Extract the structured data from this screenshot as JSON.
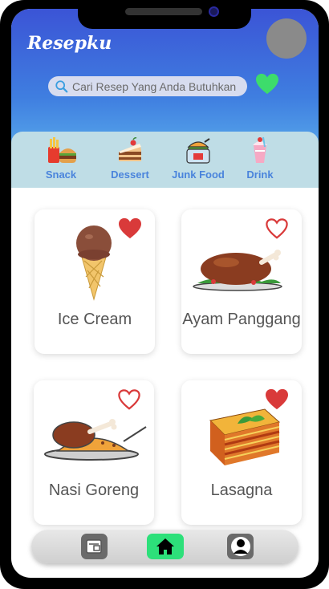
{
  "app": {
    "title": "Resepku"
  },
  "search": {
    "placeholder": "Cari Resep Yang Anda Butuhkan"
  },
  "categories": [
    {
      "label": "Snack",
      "icon": "fries-burger-icon"
    },
    {
      "label": "Dessert",
      "icon": "cake-slice-icon"
    },
    {
      "label": "Junk Food",
      "icon": "junk-food-icon"
    },
    {
      "label": "Drink",
      "icon": "milkshake-icon"
    }
  ],
  "recipes": [
    {
      "title": "Ice Cream",
      "favorite": true,
      "icon": "ice-cream-icon"
    },
    {
      "title": "Ayam Panggang",
      "favorite": false,
      "icon": "roast-chicken-icon"
    },
    {
      "title": "Nasi Goreng",
      "favorite": false,
      "icon": "fried-rice-icon"
    },
    {
      "title": "Lasagna",
      "favorite": true,
      "icon": "lasagna-icon"
    }
  ],
  "nav": [
    {
      "icon": "news-icon",
      "active": false
    },
    {
      "icon": "home-icon",
      "active": true
    },
    {
      "icon": "profile-icon",
      "active": false
    }
  ],
  "colors": {
    "header_top": "#3b54d6",
    "header_bottom": "#5fb5ee",
    "category_bar": "#bfdde6",
    "category_label": "#4a84dc",
    "heart_filled": "#d93a3a",
    "favorite_header": "#3ddc6b",
    "nav_active": "#2de07a"
  }
}
